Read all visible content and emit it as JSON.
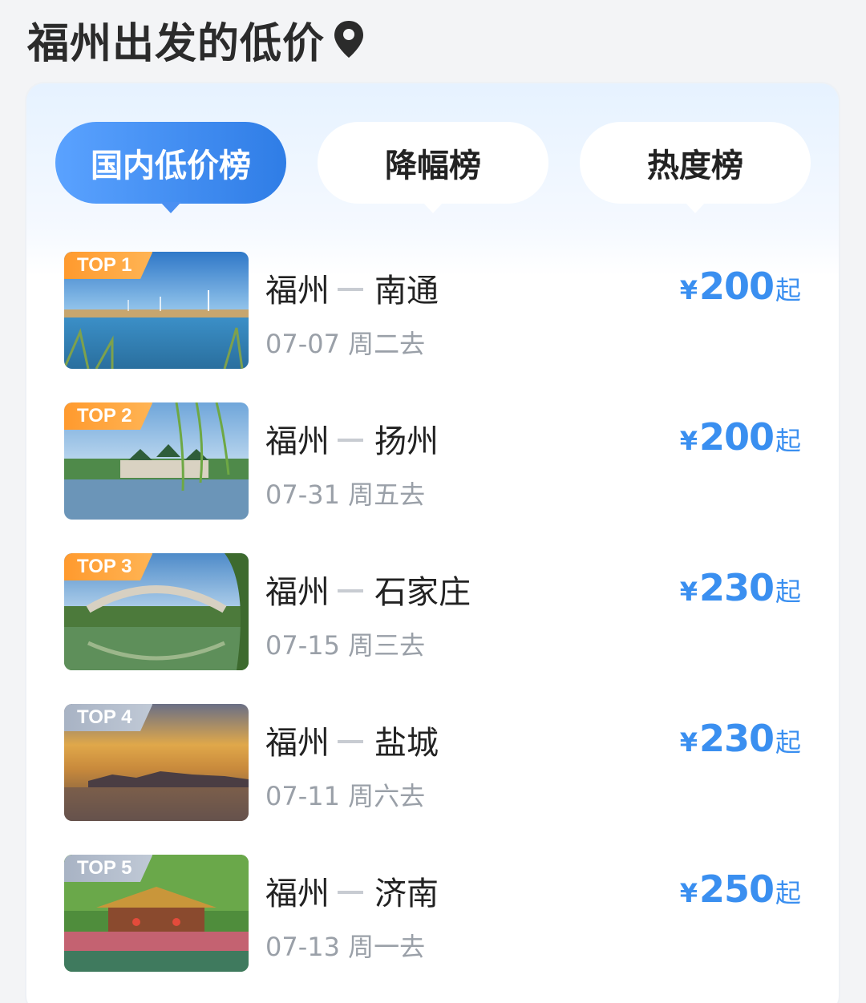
{
  "header": {
    "title": "福州出发的低价"
  },
  "tabs": [
    {
      "label": "国内低价榜",
      "active": true
    },
    {
      "label": "降幅榜",
      "active": false
    },
    {
      "label": "热度榜",
      "active": false
    }
  ],
  "colors": {
    "accent": "#3a8ff0",
    "badge_gold": "#ff9a2e",
    "badge_gray": "#a8b3c4"
  },
  "routes": [
    {
      "badge": "TOP 1",
      "from": "福州",
      "to": "南通",
      "date": "07-07 周二去",
      "currency": "¥",
      "price": "200",
      "suffix": "起"
    },
    {
      "badge": "TOP 2",
      "from": "福州",
      "to": "扬州",
      "date": "07-31 周五去",
      "currency": "¥",
      "price": "200",
      "suffix": "起"
    },
    {
      "badge": "TOP 3",
      "from": "福州",
      "to": "石家庄",
      "date": "07-15 周三去",
      "currency": "¥",
      "price": "230",
      "suffix": "起"
    },
    {
      "badge": "TOP 4",
      "from": "福州",
      "to": "盐城",
      "date": "07-11 周六去",
      "currency": "¥",
      "price": "230",
      "suffix": "起"
    },
    {
      "badge": "TOP 5",
      "from": "福州",
      "to": "济南",
      "date": "07-13 周一去",
      "currency": "¥",
      "price": "250",
      "suffix": "起"
    }
  ]
}
